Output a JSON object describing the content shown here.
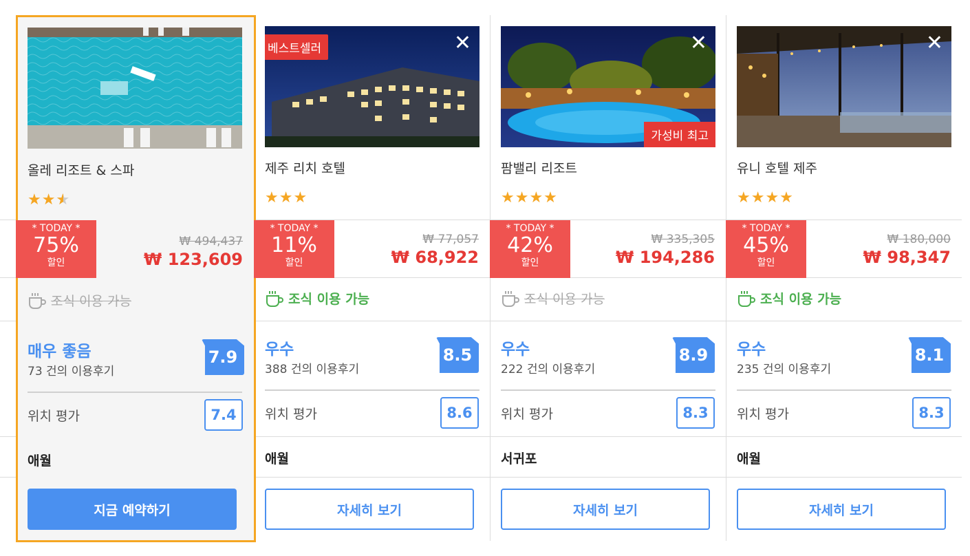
{
  "hotels": [
    {
      "name": "올레 리조트 & 스파",
      "stars_full": "★★",
      "stars_half": "★",
      "today_label": "* TODAY *",
      "discount": "75%",
      "discount_suffix": "할인",
      "original_price": "₩ 494,437",
      "price": "₩ 123,609",
      "breakfast": "조식 이용 가능",
      "breakfast_available": false,
      "grade": "매우 좋음",
      "reviews": "73 건의 이용후기",
      "score": "7.9",
      "location_label": "위치 평가",
      "location_score": "7.4",
      "area": "애월",
      "button": "지금 예약하기"
    },
    {
      "name": "제주 리치 호텔",
      "stars_full": "★★★",
      "badge": "베스트셀러",
      "close_icon": "✕",
      "today_label": "* TODAY *",
      "discount": "11%",
      "discount_suffix": "할인",
      "original_price": "₩ 77,057",
      "price": "₩ 68,922",
      "breakfast": "조식 이용 가능",
      "breakfast_available": true,
      "grade": "우수",
      "reviews": "388 건의 이용후기",
      "score": "8.5",
      "location_label": "위치 평가",
      "location_score": "8.6",
      "area": "애월",
      "button": "자세히 보기"
    },
    {
      "name": "팜밸리 리조트",
      "stars_full": "★★★★",
      "badge": "가성비 최고",
      "close_icon": "✕",
      "today_label": "* TODAY *",
      "discount": "42%",
      "discount_suffix": "할인",
      "original_price": "₩ 335,305",
      "price": "₩ 194,286",
      "breakfast": "조식 이용 가능",
      "breakfast_available": false,
      "grade": "우수",
      "reviews": "222 건의 이용후기",
      "score": "8.9",
      "location_label": "위치 평가",
      "location_score": "8.3",
      "area": "서귀포",
      "button": "자세히 보기"
    },
    {
      "name": "유니 호텔 제주",
      "stars_full": "★★★★",
      "close_icon": "✕",
      "today_label": "* TODAY *",
      "discount": "45%",
      "discount_suffix": "할인",
      "original_price": "₩ 180,000",
      "price": "₩ 98,347",
      "breakfast": "조식 이용 가능",
      "breakfast_available": true,
      "grade": "우수",
      "reviews": "235 건의 이용후기",
      "score": "8.1",
      "location_label": "위치 평가",
      "location_score": "8.3",
      "area": "애월",
      "button": "자세히 보기"
    }
  ],
  "colors": {
    "accent_blue": "#4a90f0",
    "sale_red": "#e53935",
    "star_orange": "#f5a623",
    "breakfast_green": "#4caf50",
    "highlight_border": "#f5a623"
  }
}
